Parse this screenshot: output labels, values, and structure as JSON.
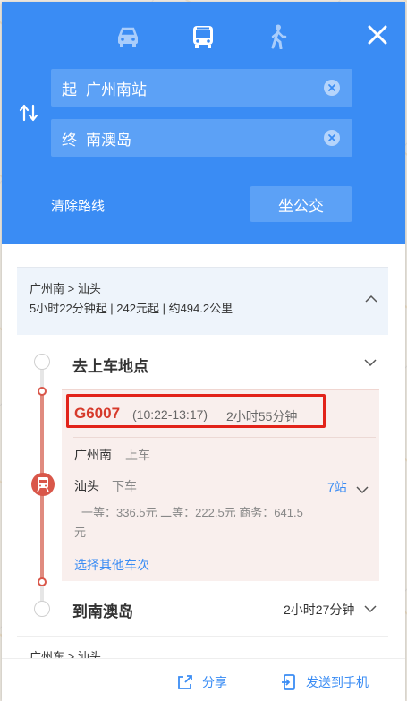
{
  "modes": {
    "car": "car-icon",
    "bus": "bus-icon",
    "walk": "walk-icon",
    "active": "bus"
  },
  "route_input": {
    "start_tag": "起",
    "start_value": "广州南站",
    "end_tag": "终",
    "end_value": "南澳岛"
  },
  "actions": {
    "clear_route": "清除路线",
    "take_bus": "坐公交"
  },
  "summary": {
    "route": "广州南 > 汕头",
    "info": "5小时22分钟起 | 242元起 | 约494.2公里"
  },
  "steps": {
    "board_title": "去上车地点",
    "arrive_title": "到南澳岛",
    "arrive_duration": "2小时27分钟"
  },
  "train": {
    "number": "G6007",
    "time": "(10:22-13:17)",
    "duration": "2小时55分钟",
    "board_station": "广州南",
    "board_action": "上车",
    "alight_station": "汕头",
    "alight_action": "下车",
    "stops": "7站",
    "price": "一等：336.5元 二等：222.5元 商务：641.5元",
    "other_trains": "选择其他车次"
  },
  "next_route": "广州东 > 汕头",
  "bottom": {
    "share": "分享",
    "send_to_phone": "发送到手机"
  },
  "colors": {
    "primary": "#3a8cf4",
    "train_red": "#d63a2b",
    "highlight": "#e2231a"
  }
}
